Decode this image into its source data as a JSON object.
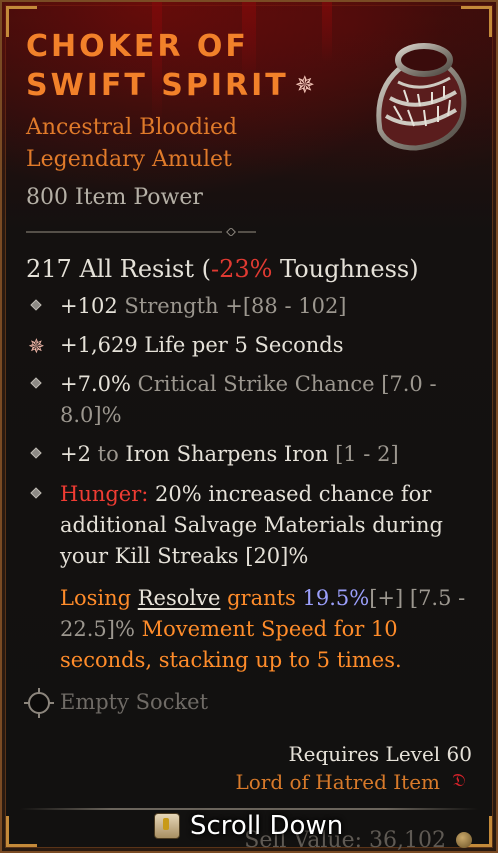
{
  "item": {
    "name": "CHOKER OF SWIFT SPIRIT",
    "type_line1": "Ancestral Bloodied",
    "type_line2": "Legendary Amulet",
    "power": "800 Item Power"
  },
  "implicit": {
    "value": "217 All Resist (",
    "toughness": "-23%",
    "toughness_label": " Toughness)"
  },
  "affixes": [
    {
      "value": "+102",
      "stat": " Strength ",
      "range": "+[88 - 102]"
    },
    {
      "value": "+1,629 Life per 5 Seconds"
    },
    {
      "value": "+7.0%",
      "stat": " Critical Strike Chance ",
      "range": "[7.0 -",
      "range2": "8.0]%"
    },
    {
      "value": "+2",
      "to": " to ",
      "stat": "Iron Sharpens Iron",
      "range": " [1 - 2]"
    }
  ],
  "hunger": {
    "label": "Hunger:",
    "line1": " 20% increased chance for",
    "line2": "additional Salvage Materials during",
    "line3": "your Kill Streaks [20]%"
  },
  "legendary": {
    "part1": "Losing ",
    "resolve": "Resolve",
    "part2": " grants ",
    "value": "19.5%",
    "plus": "[+]",
    "range1": " [7.5 -",
    "range2": "22.5]%",
    "part3": " Movement Speed for 10",
    "line3": "seconds, stacking up to 5 times."
  },
  "socket": {
    "label": "Empty Socket"
  },
  "footer": {
    "requires": "Requires Level 60",
    "expansion": "Lord of Hatred Item",
    "scroll": "Scroll Down",
    "sell": "Sell Value: 36,102"
  },
  "colors": {
    "title": "#f2812a",
    "legendary": "#e07a2a",
    "negative": "#e03a32",
    "hunger": "#ef3c33",
    "highlight": "#9b9ffb"
  },
  "icons": [
    "sparkle-icon",
    "amulet-icon",
    "diamond-bullet-icon",
    "life-star-icon",
    "socket-icon",
    "expansion-icon",
    "key-icon",
    "gold-coin-icon"
  ]
}
